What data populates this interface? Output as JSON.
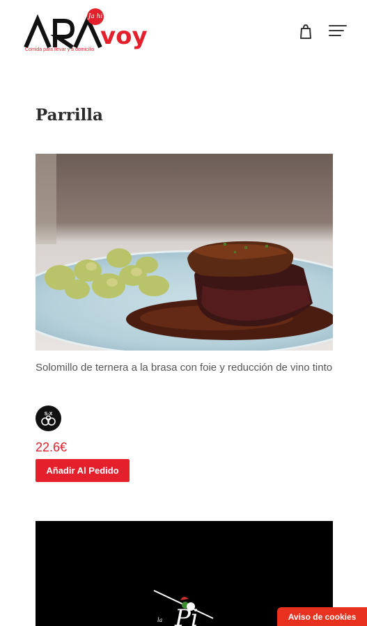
{
  "header": {
    "logo_text": "ARA",
    "logo_badge": "Ja hi",
    "logo_accent": "voy",
    "logo_tagline": "Comida para llevar y a domicilio",
    "icons": [
      "shopping-bag-icon",
      "hamburger-menu-icon"
    ]
  },
  "category": {
    "title": "Parrilla"
  },
  "product": {
    "name": "Solomillo de ternera a la brasa con foie y reducción de vino tinto",
    "price": "22.6€",
    "add_label": "Añadir Al Pedido",
    "allergen_icon": "sulphites-allergen-icon"
  },
  "cookie": {
    "label": "Aviso de cookies"
  },
  "colors": {
    "brand_red": "#e3202b",
    "text_dark": "#2b2b2b",
    "text_body": "#555555"
  }
}
